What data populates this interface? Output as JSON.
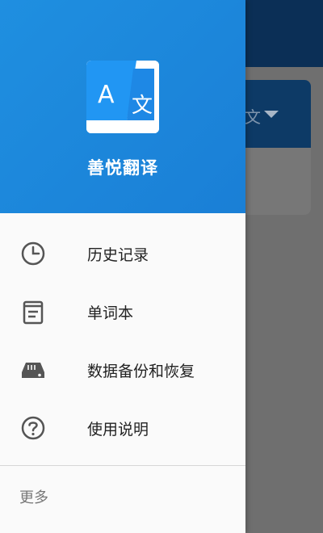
{
  "background": {
    "language_fragment": "文"
  },
  "drawer": {
    "app_name": "善悦翻译",
    "menu": [
      {
        "label": "历史记录",
        "icon": "clock-icon"
      },
      {
        "label": "单词本",
        "icon": "notebook-icon"
      },
      {
        "label": "数据备份和恢复",
        "icon": "storage-drive-icon"
      },
      {
        "label": "使用说明",
        "icon": "help-circle-icon"
      }
    ],
    "more_label": "更多"
  },
  "colors": {
    "header_blue": "#1a86dc",
    "logo_blue": "#2196f3",
    "overlay_gray": "#6f6f6f"
  }
}
